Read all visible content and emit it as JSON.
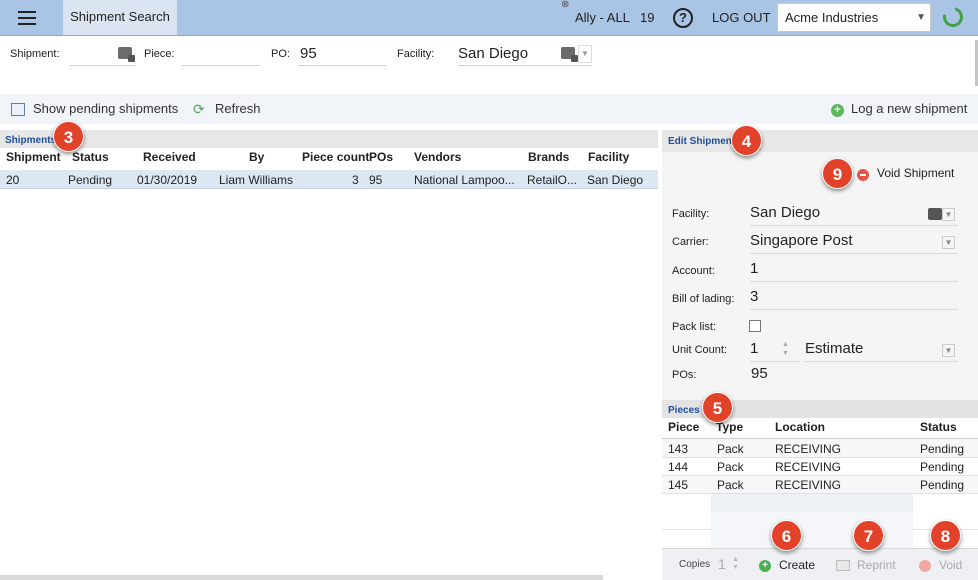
{
  "header": {
    "tab_title": "Shipment Search",
    "close_mark": "⊗",
    "user": "Ally - ALL",
    "count": "19",
    "help": "?",
    "logout": "LOG OUT",
    "company": "Acme Industries",
    "company_arrow": "▼"
  },
  "filters": {
    "shipment_label": "Shipment:",
    "shipment_value": "",
    "piece_label": "Piece:",
    "piece_value": "",
    "po_label": "PO:",
    "po_value": "95",
    "facility_label": "Facility:",
    "facility_value": "San Diego"
  },
  "toolbar": {
    "pending_label": "Show pending shipments",
    "refresh_label": "Refresh",
    "log_label": "Log a new shipment"
  },
  "shipments": {
    "section_title": "Shipments",
    "columns": [
      "Shipment",
      "Status",
      "Received",
      "By",
      "Piece count",
      "POs",
      "Vendors",
      "Brands",
      "Facility"
    ],
    "rows": [
      {
        "shipment": "20",
        "status": "Pending",
        "received": "01/30/2019",
        "by": "Liam Williams",
        "piece_count": "3",
        "pos": "95",
        "vendors": "National Lampoo...",
        "brands": "RetailO...",
        "facility": "San Diego"
      }
    ]
  },
  "edit": {
    "section_title": "Edit Shipment",
    "void_label": "Void Shipment",
    "facility_label": "Facility:",
    "facility_value": "San Diego",
    "carrier_label": "Carrier:",
    "carrier_value": "Singapore Post",
    "account_label": "Account:",
    "account_value": "1",
    "bol_label": "Bill of lading:",
    "bol_value": "3",
    "packlist_label": "Pack list:",
    "unitcount_label": "Unit Count:",
    "unitcount_value": "1",
    "unit_type": "Estimate",
    "pos_label": "POs:",
    "pos_value": "95"
  },
  "pieces": {
    "section_title": "Pieces",
    "columns": [
      "Piece",
      "Type",
      "Location",
      "Status"
    ],
    "rows": [
      {
        "piece": "143",
        "type": "Pack",
        "location": "RECEIVING",
        "status": "Pending"
      },
      {
        "piece": "144",
        "type": "Pack",
        "location": "RECEIVING",
        "status": "Pending"
      },
      {
        "piece": "145",
        "type": "Pack",
        "location": "RECEIVING",
        "status": "Pending"
      }
    ]
  },
  "footer": {
    "copies_label": "Copies",
    "copies_value": "1",
    "create_label": "Create",
    "reprint_label": "Reprint",
    "void_label": "Void"
  },
  "badges": {
    "b3": "3",
    "b4": "4",
    "b5": "5",
    "b6": "6",
    "b7": "7",
    "b8": "8",
    "b9": "9"
  },
  "colors": {
    "topbar": "#a9c4e4",
    "section_title": "#1f4ea0",
    "badge": "#e2412a",
    "selected_row": "#dde7f3",
    "create_icon": "#4caf50",
    "void_icon": "#e5534b"
  }
}
